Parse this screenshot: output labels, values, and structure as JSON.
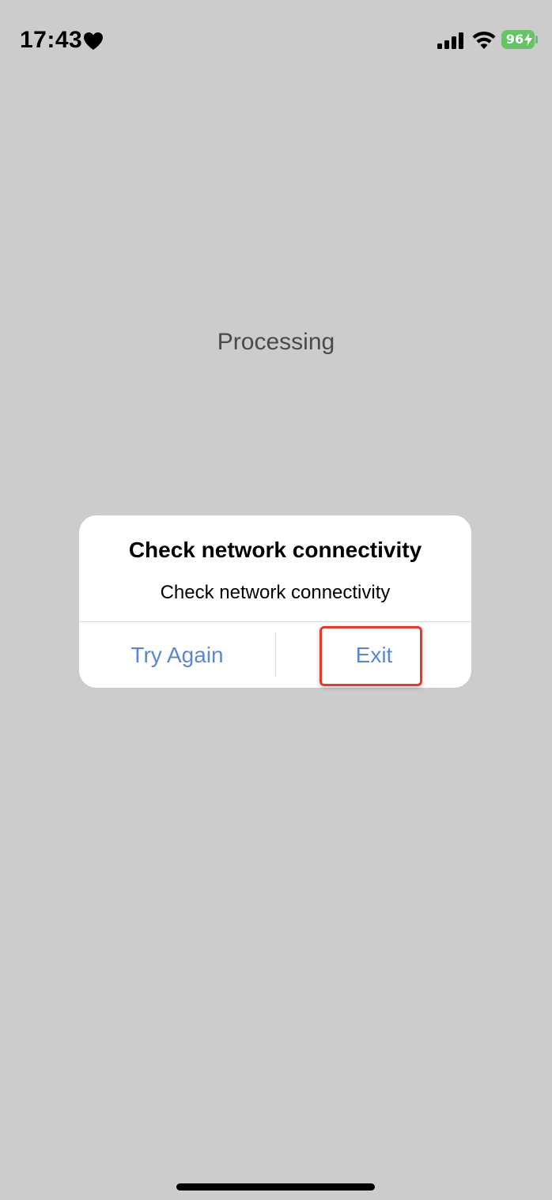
{
  "status_bar": {
    "time": "17:43",
    "battery_level": "96",
    "heart_icon": "heart-icon",
    "signal_icon": "cellular-signal-icon",
    "wifi_icon": "wifi-icon",
    "battery_color": "#65c466"
  },
  "main": {
    "processing_text": "Processing"
  },
  "alert": {
    "title": "Check network connectivity",
    "message": "Check network connectivity",
    "buttons": {
      "try_again": "Try Again",
      "exit": "Exit"
    },
    "button_color": "#5a87cf"
  },
  "annotation": {
    "highlight_color": "#e03b2f",
    "highlighted_target": "exit-button"
  }
}
